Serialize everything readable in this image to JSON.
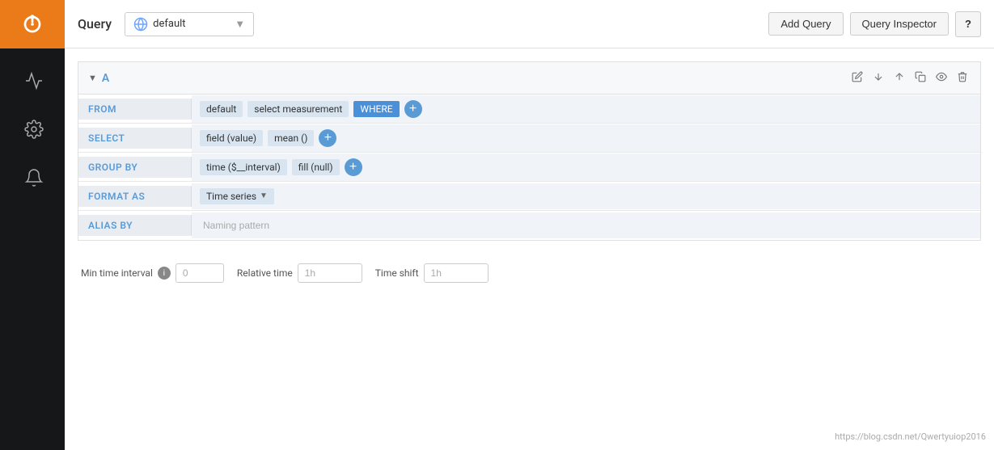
{
  "sidebar": {
    "items": [
      {
        "name": "logo",
        "icon": "grafana-logo"
      },
      {
        "name": "chart",
        "icon": "chart-icon"
      },
      {
        "name": "settings",
        "icon": "settings-icon"
      },
      {
        "name": "alerts",
        "icon": "alert-icon"
      }
    ]
  },
  "header": {
    "title": "Query",
    "datasource": {
      "name": "default",
      "icon": "datasource-icon"
    },
    "buttons": {
      "add_query": "Add Query",
      "query_inspector": "Query Inspector",
      "help": "?"
    }
  },
  "query_block": {
    "letter": "A",
    "rows": {
      "from": {
        "label": "FROM",
        "tags": [
          "default",
          "select measurement"
        ],
        "where_label": "WHERE",
        "add": true
      },
      "select": {
        "label": "SELECT",
        "tags": [
          "field (value)",
          "mean ()"
        ],
        "add": true
      },
      "group_by": {
        "label": "GROUP BY",
        "tags": [
          "time ($__interval)",
          "fill (null)"
        ],
        "add": true
      },
      "format_as": {
        "label": "FORMAT AS",
        "value": "Time series"
      },
      "alias_by": {
        "label": "ALIAS BY",
        "placeholder": "Naming pattern"
      }
    },
    "actions": {
      "edit": "✏",
      "down": "↓",
      "up": "↑",
      "copy": "⊞",
      "eye": "👁",
      "delete": "🗑"
    }
  },
  "bottom": {
    "min_time_interval": {
      "label": "Min time interval",
      "placeholder": "0"
    },
    "relative_time": {
      "label": "Relative time",
      "placeholder": "1h"
    },
    "time_shift": {
      "label": "Time shift",
      "placeholder": "1h"
    }
  },
  "watermark": "https://blog.csdn.net/Qwertyuiop2016"
}
